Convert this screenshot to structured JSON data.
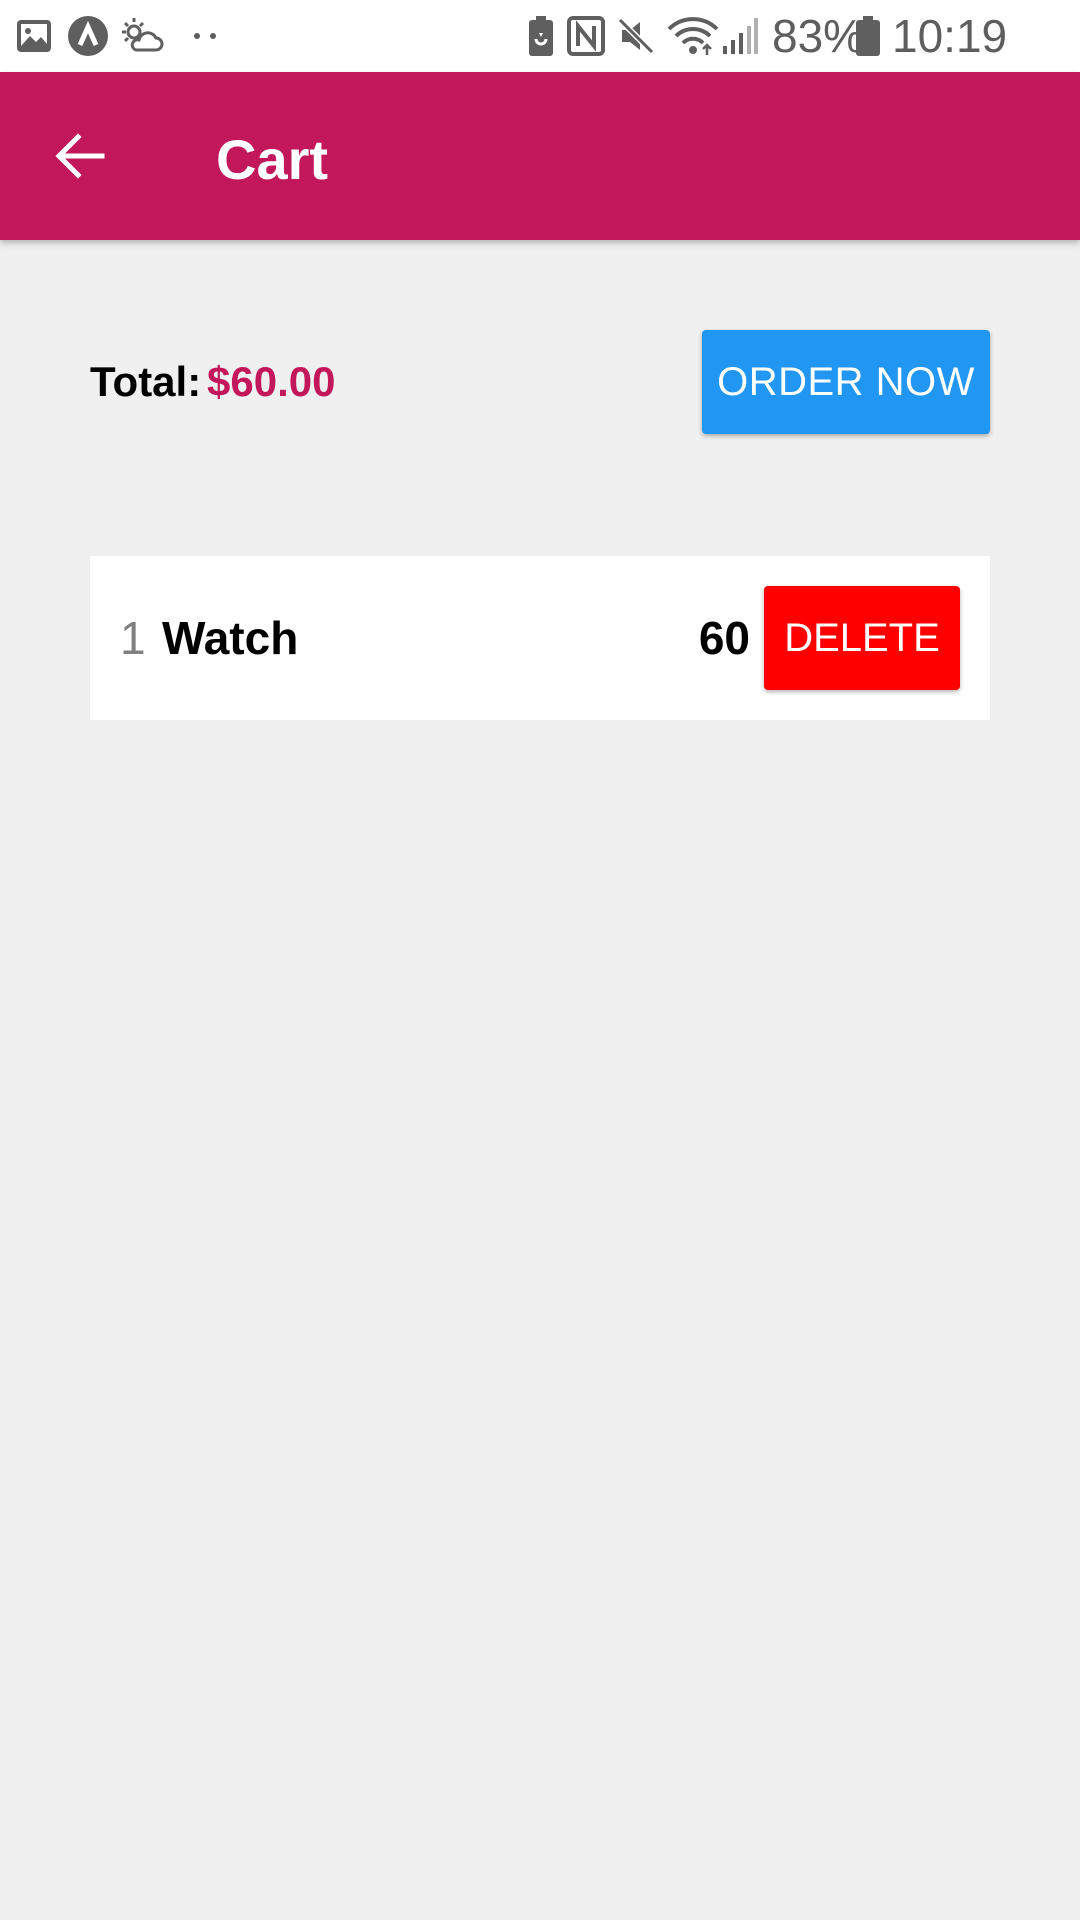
{
  "status_bar": {
    "battery_percent": "83%",
    "time": "10:19 AM",
    "icons": [
      "image-icon",
      "app-badge-icon",
      "weather-icon",
      "more-dots-icon",
      "battery-saver-icon",
      "nfc-icon",
      "mute-icon",
      "wifi-icon",
      "signal-icon",
      "battery-icon"
    ]
  },
  "app_bar": {
    "title": "Cart",
    "color": "#c2185b"
  },
  "summary": {
    "total_label": "Total:",
    "total_amount": "$60.00",
    "order_button_label": "ORDER NOW",
    "order_button_color": "#2196f3"
  },
  "cart_items": [
    {
      "quantity": "1",
      "name": "Watch",
      "price": "60",
      "delete_label": "DELETE"
    }
  ],
  "colors": {
    "background": "#f0f0f1",
    "delete": "#ff0000"
  }
}
